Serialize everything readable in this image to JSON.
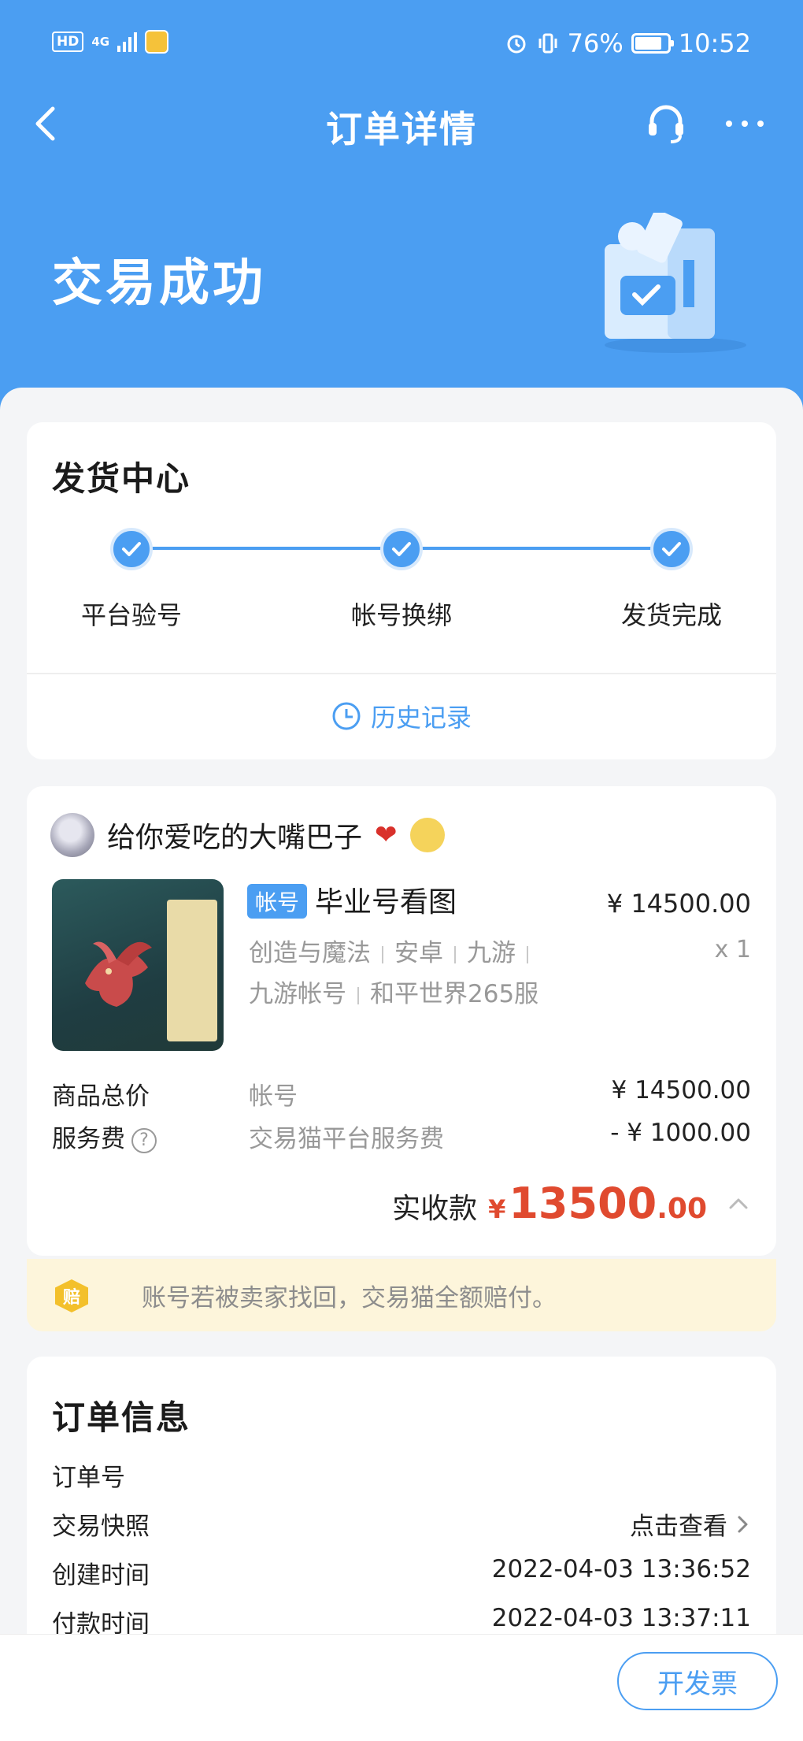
{
  "status_bar": {
    "hd": "HD",
    "network": "4G",
    "battery": "76%",
    "battery_level": 0.76,
    "time": "10:52"
  },
  "nav": {
    "title": "订单详情",
    "icons": [
      "back-arrow-icon",
      "headset-icon",
      "more-icon"
    ]
  },
  "status": {
    "title": "交易成功"
  },
  "delivery": {
    "title": "发货中心",
    "steps": [
      "平台验号",
      "帐号换绑",
      "发货完成"
    ],
    "history": "历史记录"
  },
  "product": {
    "seller": "给你爱吃的大嘴巴子",
    "tag": "帐号",
    "title": "毕业号看图",
    "price": "¥ 14500.00",
    "qty": "x 1",
    "meta_line1": [
      "创造与魔法",
      "安卓",
      "九游"
    ],
    "meta_line2": [
      "九游帐号",
      "和平世界265服"
    ],
    "fees": [
      {
        "label": "商品总价",
        "desc": "帐号",
        "amount": "¥ 14500.00"
      },
      {
        "label": "服务费",
        "desc": "交易猫平台服务费",
        "amount": "- ¥ 1000.00"
      }
    ],
    "total_label": "实收款",
    "total_currency": "¥",
    "total_int": "13500",
    "total_dec": ".00"
  },
  "guarantee": {
    "badge": "赔",
    "text": "账号若被卖家找回，交易猫全额赔付。"
  },
  "order": {
    "title": "订单信息",
    "rows": [
      {
        "key": "订单号",
        "value": ""
      },
      {
        "key": "交易快照",
        "value": "点击查看"
      },
      {
        "key": "创建时间",
        "value": "2022-04-03 13:36:52"
      },
      {
        "key": "付款时间",
        "value": "2022-04-03 13:37:11"
      }
    ]
  },
  "bottom": {
    "invoice": "开发票"
  },
  "colors": {
    "accent": "#4b9ef2",
    "price": "#e04a2f",
    "guarantee_bg": "#fdf5db"
  }
}
